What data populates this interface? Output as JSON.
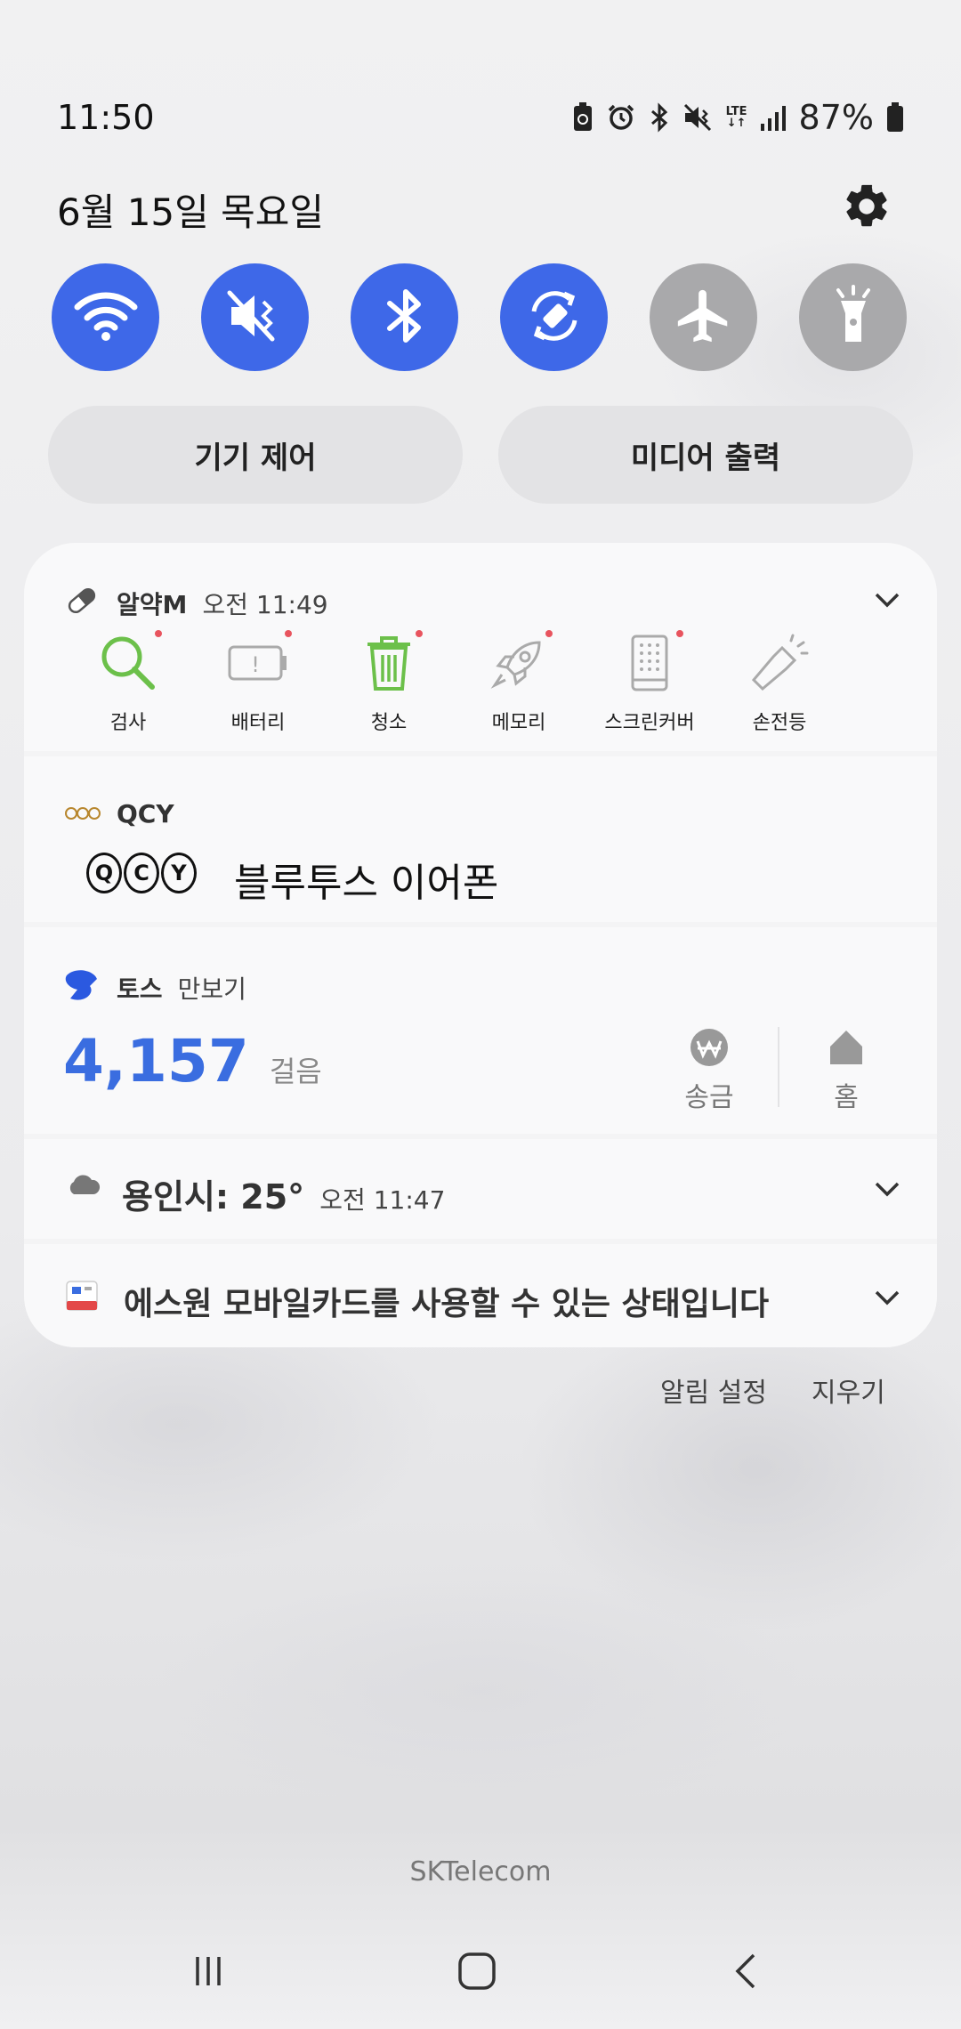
{
  "status_bar": {
    "time": "11:50",
    "network": "LTE",
    "battery": "87%"
  },
  "date": "6월 15일 목요일",
  "quick_settings": {
    "toggles": [
      {
        "icon": "wifi-icon",
        "state": "on"
      },
      {
        "icon": "sound-mute-vibrate-icon",
        "state": "on"
      },
      {
        "icon": "bluetooth-icon",
        "state": "on"
      },
      {
        "icon": "auto-rotate-icon",
        "state": "on"
      },
      {
        "icon": "airplane-icon",
        "state": "off"
      },
      {
        "icon": "flashlight-icon",
        "state": "off"
      }
    ],
    "device_control": "기기 제어",
    "media_output": "미디어 출력"
  },
  "notifications": {
    "almyak": {
      "app": "알약M",
      "time": "오전 11:49",
      "shortcuts": [
        {
          "label": "검사",
          "icon": "magnifier-icon"
        },
        {
          "label": "배터리",
          "icon": "battery-alert-icon"
        },
        {
          "label": "청소",
          "icon": "trash-icon"
        },
        {
          "label": "메모리",
          "icon": "rocket-icon"
        },
        {
          "label": "스크린커버",
          "icon": "phone-screen-icon"
        },
        {
          "label": "손전등",
          "icon": "flashlight-icon"
        }
      ]
    },
    "qcy": {
      "app": "QCY",
      "logo": "QCY",
      "title": "블루투스 이어폰"
    },
    "toss": {
      "app": "토스",
      "subtitle": "만보기",
      "steps": "4,157",
      "unit": "걸음",
      "actions": [
        "송금",
        "홈"
      ]
    },
    "weather": {
      "text": "용인시: 25°",
      "time": "오전 11:47"
    },
    "card": {
      "text": "에스원 모바일카드를 사용할 수 있는 상태입니다"
    }
  },
  "footer": {
    "notification_settings": "알림 설정",
    "clear": "지우기"
  },
  "carrier": "SKTelecom",
  "colors": {
    "accent": "#3e68e8",
    "toggle_off": "#a9a9ab",
    "toss_blue": "#3a6de0",
    "almyak_green": "#6cc04a"
  }
}
